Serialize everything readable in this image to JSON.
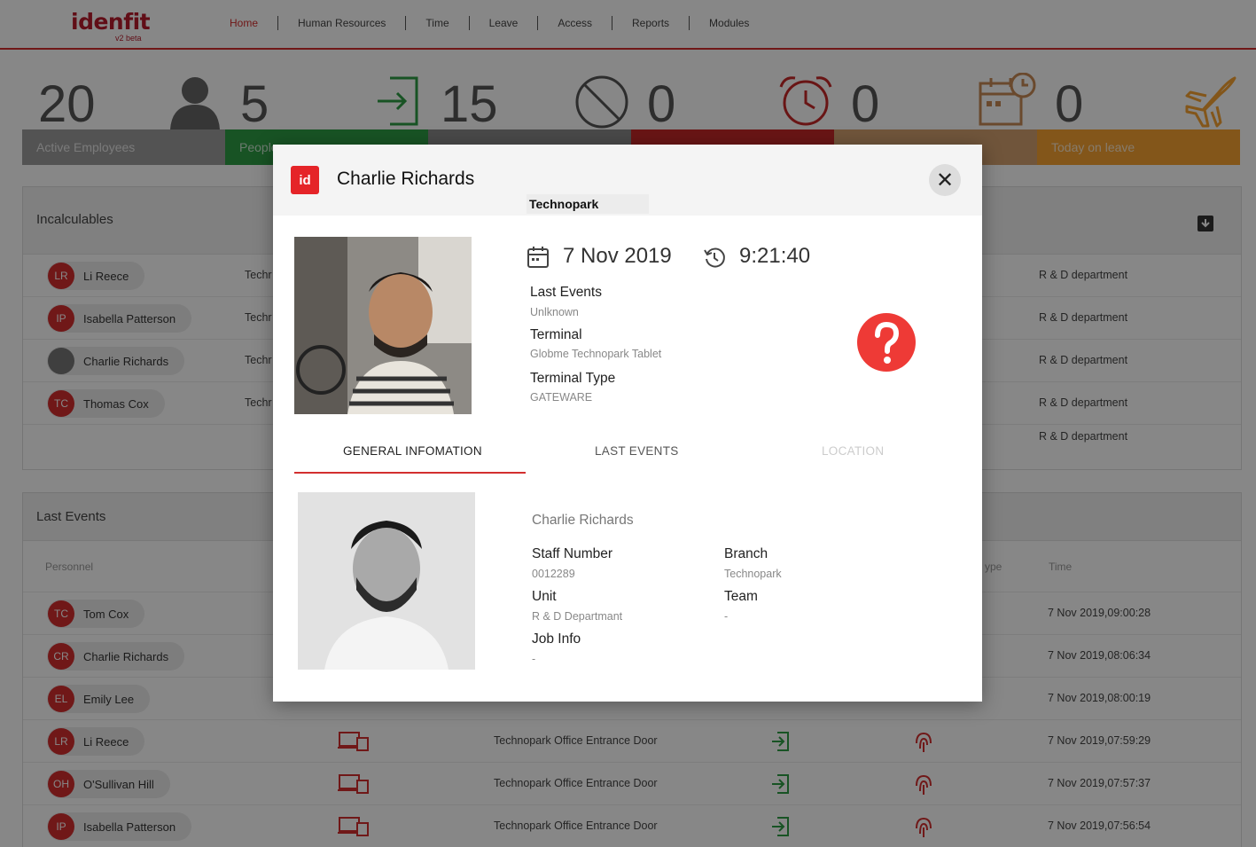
{
  "app": {
    "brand": "idenfit",
    "version": "v2 beta"
  },
  "nav": [
    "Home",
    "Human Resources",
    "Time",
    "Leave",
    "Access",
    "Reports",
    "Modules"
  ],
  "stats": [
    {
      "value": "20",
      "label": "Active Employees",
      "color": "#9e9e9e"
    },
    {
      "value": "5",
      "label": "People",
      "color": "#2e9e44"
    },
    {
      "value": "15",
      "label": "",
      "color": "#8a8a8a"
    },
    {
      "value": "0",
      "label": "",
      "color": "#c62828"
    },
    {
      "value": "0",
      "label": "",
      "color": "#d4a070"
    },
    {
      "value": "0",
      "label": "Today on leave",
      "color": "#f7a331"
    }
  ],
  "incalculables": {
    "title": "Incalculables",
    "rows": [
      {
        "initials": "LR",
        "name": "Li Reece",
        "branch": "Techr",
        "department": "R & D department"
      },
      {
        "initials": "IP",
        "name": "Isabella Patterson",
        "branch": "Techr",
        "department": "R & D department"
      },
      {
        "initials": "",
        "name": "Charlie Richards",
        "branch": "Techr",
        "department": "R & D department"
      },
      {
        "initials": "TC",
        "name": "Thomas Cox",
        "branch": "Techr",
        "department": "R & D department"
      },
      {
        "initials": "",
        "name": "",
        "branch": "",
        "department": "R & D department"
      }
    ]
  },
  "last_events": {
    "title": "Last Events",
    "columns": {
      "personnel": "Personnel",
      "type": "ype",
      "time": "Time"
    },
    "rows": [
      {
        "initials": "TC",
        "name": "Tom Cox",
        "door": "",
        "time": "7 Nov 2019,09:00:28"
      },
      {
        "initials": "CR",
        "name": "Charlie Richards",
        "door": "",
        "time": "7 Nov 2019,08:06:34"
      },
      {
        "initials": "EL",
        "name": "Emily Lee",
        "door": "",
        "time": "7 Nov 2019,08:00:19"
      },
      {
        "initials": "LR",
        "name": "Li Reece",
        "door": "Technopark Office Entrance Door",
        "time": "7 Nov 2019,07:59:29"
      },
      {
        "initials": "OH",
        "name": "O'Sullivan Hill",
        "door": "Technopark Office Entrance Door",
        "time": "7 Nov 2019,07:57:37"
      },
      {
        "initials": "IP",
        "name": "Isabella Patterson",
        "door": "Technopark Office Entrance Door",
        "time": "7 Nov 2019,07:56:54"
      }
    ]
  },
  "modal": {
    "logo": "id",
    "name": "Charlie Richards",
    "branch_tag": "Technopark",
    "date": "7 Nov 2019",
    "time": "9:21:40",
    "last_events_label": "Last Events",
    "last_events_value": "Unlknown",
    "terminal_label": "Terminal",
    "terminal_value": "Globme Technopark Tablet",
    "terminal_type_label": "Terminal Type",
    "terminal_type_value": "GATEWARE",
    "tabs": [
      "GENERAL INFOMATION",
      "LAST EVENTS",
      "LOCATION"
    ],
    "general": {
      "full_name": "Charlie Richards",
      "staff_number_label": "Staff Number",
      "staff_number": "0012289",
      "branch_label": "Branch",
      "branch": "Technopark",
      "unit_label": "Unit",
      "unit": "R & D Departmant",
      "team_label": "Team",
      "team": "-",
      "job_info_label": "Job Info",
      "job_info": "-"
    }
  },
  "colors": {
    "accent": "#d32f2f",
    "question": "#ee3a36",
    "green": "#2e9e44"
  }
}
